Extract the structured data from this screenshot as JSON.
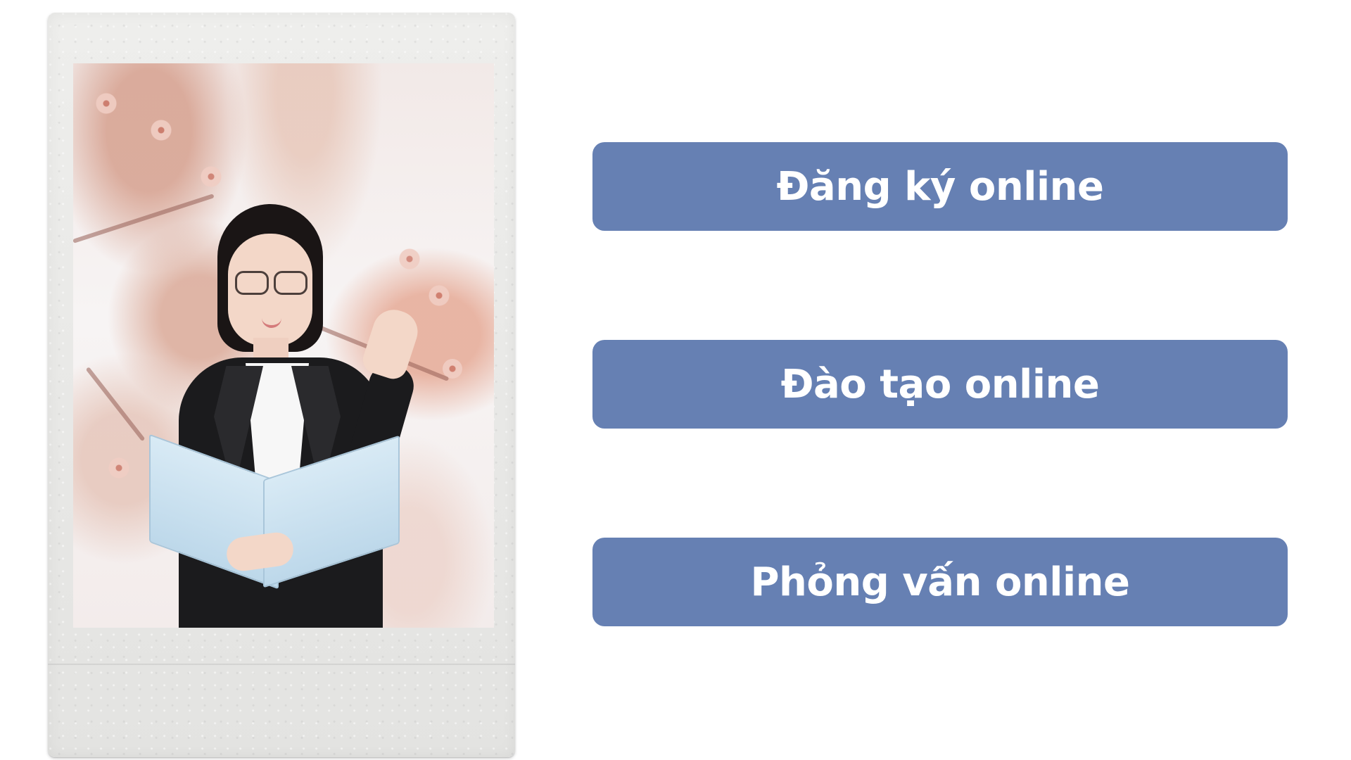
{
  "buttons": {
    "register": "Đăng ký online",
    "training": "Đào tạo online",
    "interview": "Phỏng vấn online"
  },
  "colors": {
    "button_background": "#6680b3",
    "button_text": "#ffffff",
    "page_background": "#ffffff",
    "polaroid_frame": "#ebebe9"
  },
  "image": {
    "description_icon": "photo-frame"
  }
}
